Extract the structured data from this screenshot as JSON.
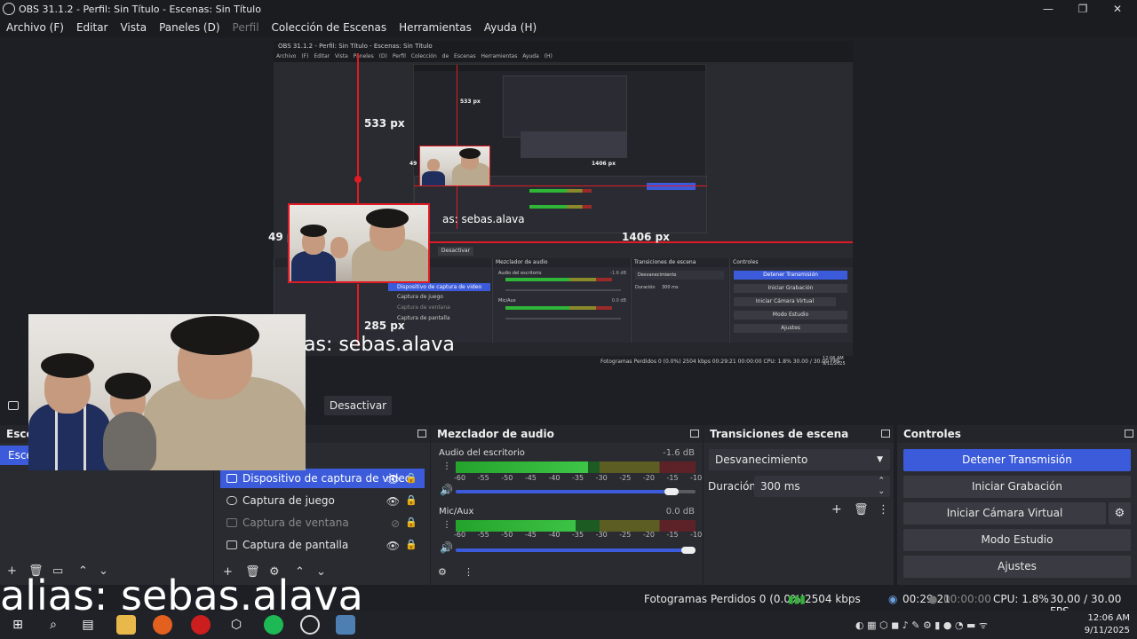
{
  "window": {
    "title": "OBS 31.1.2 - Perfil: Sin Título - Escenas: Sin Título",
    "minimize": "—",
    "restore": "❐",
    "close": "✕"
  },
  "menu": [
    "Archivo (F)",
    "Editar",
    "Vista",
    "Paneles (D)",
    "Perfil",
    "Colección de Escenas",
    "Herramientas",
    "Ayuda (H)"
  ],
  "preview": {
    "inner_title": "OBS 31.1.2 - Perfil: Sin Título - Escenas: Sin Título",
    "inner_menu": "Archivo (F) Editar Vista Paneles (D) Perfil Colección de Escenas Herramientas Ayuda (H)",
    "measure_top": "533 px",
    "measure_left": "49 px",
    "measure_right": "1406 px",
    "measure_bottom": "285 px",
    "nested_top": "533 px",
    "nested_left": "49 px",
    "nested_right": "1406 px",
    "alias_mid": "as: sebas.alava",
    "alias_small": "as: sebas.alava",
    "inner_deact": "Desactivar",
    "inner_panels": {
      "mixer": "Mezclador de audio",
      "transitions": "Transiciones de escena",
      "controls": "Controles",
      "desk": "Audio del escritorio",
      "mic": "Mic/Aux",
      "fade": "Desvanecimiento",
      "duration": "Duración",
      "duration_val": "300 ms",
      "stop": "Detener Transmisión",
      "rec": "Iniciar Grabación",
      "vcam": "Iniciar Cámara Virtual",
      "studio": "Modo Estudio",
      "settings": "Ajustes",
      "src_sel": "Dispositivo de captura de video",
      "src_game": "Captura de juego",
      "src_win": "Captura de ventana",
      "src_screen": "Captura de pantalla",
      "status": "Fotogramas Perdidos 0 (0.0%)   2504 kbps   00:29:21   00:00:00   CPU: 1.8%   30.00 / 30.00 FPS",
      "clock": "12:06 AM 9/11/2025",
      "db1": "-1.6 dB",
      "db2": "0.0 dB"
    }
  },
  "deactivate_label": "Desactivar",
  "scenes": {
    "title": "Escen",
    "item": "Esce"
  },
  "sources": {
    "items": [
      {
        "label": "Dispositivo de captura de video",
        "selected": true,
        "visible": true
      },
      {
        "label": "Captura de juego",
        "selected": false,
        "visible": true
      },
      {
        "label": "Captura de ventana",
        "selected": false,
        "visible": false
      },
      {
        "label": "Captura de pantalla",
        "selected": false,
        "visible": true
      }
    ]
  },
  "mixer": {
    "title": "Mezclador de audio",
    "channels": [
      {
        "name": "Audio del escritorio",
        "db": "-1.6 dB",
        "level": 0.55,
        "volume": 0.93
      },
      {
        "name": "Mic/Aux",
        "db": "0.0 dB",
        "level": 0.5,
        "volume": 1.0
      }
    ],
    "ticks": "-60 -55 -50 -45 -40 -35 -30 -25 -20 -15 -10 -5 0"
  },
  "transitions": {
    "title": "Transiciones de escena",
    "selected": "Desvanecimiento",
    "duration_label": "Duración",
    "duration_value": "300 ms"
  },
  "controls": {
    "title": "Controles",
    "buttons": [
      "Detener Transmisión",
      "Iniciar Grabación",
      "Iniciar Cámara Virtual",
      "Modo Estudio",
      "Ajustes"
    ]
  },
  "status": {
    "dropped": "Fotogramas Perdidos 0 (0.0%)",
    "bitrate": "2504 kbps",
    "stream_time": "00:29:21",
    "rec_time": "00:00:00",
    "cpu": "CPU: 1.8%",
    "fps": "30.00 / 30.00 FPS"
  },
  "overlay": {
    "alias": "alias: sebas.alava"
  },
  "taskbar": {
    "time": "12:06 AM",
    "date": "9/11/2025"
  },
  "colors": {
    "accent": "#3b5bdb",
    "red": "#e01b24",
    "meter_green": "#2fb537",
    "bg": "#1e1f24"
  }
}
